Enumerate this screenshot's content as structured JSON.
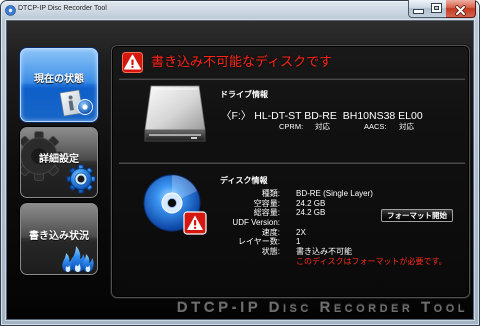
{
  "window": {
    "title": "DTCP-IP Disc Recorder Tool",
    "app_icon": "disc-icon",
    "controls": [
      "minimize-icon",
      "maximize-icon",
      "close-icon"
    ]
  },
  "sidebar": {
    "items": [
      {
        "label": "現在の状態",
        "icon": "info-document-icon",
        "active": true
      },
      {
        "label": "詳細設定",
        "icon": "gear-icon",
        "active": false
      },
      {
        "label": "書き込み状況",
        "icon": "flame-icon",
        "active": false
      }
    ]
  },
  "status": {
    "icon": "warning-icon",
    "message": "書き込み不可能なディスクです"
  },
  "drive": {
    "heading": "ドライブ情報",
    "icon": "optical-drive-icon",
    "name": "〈F:〉 HL-DT-ST BD-RE  BH10NS38 EL00",
    "cprm": {
      "label": "CPRM:",
      "value": "対応"
    },
    "aacs": {
      "label": "AACS:",
      "value": "対応"
    }
  },
  "disc": {
    "heading": "ディスク情報",
    "icon": "disc-warning-icon",
    "rows": [
      {
        "label": "種類:",
        "value": "BD-RE (Single Layer)"
      },
      {
        "label": "空容量:",
        "value": "24.2 GB"
      },
      {
        "label": "総容量:",
        "value": "24.2 GB"
      },
      {
        "label": "UDF Version:"
      },
      {
        "label": "速度:",
        "value": "2X"
      },
      {
        "label": "レイヤー数:",
        "value": "1"
      },
      {
        "label": "状態:",
        "value": "書き込み不可能"
      }
    ],
    "notice": "このディスクはフォーマットが必要です。",
    "format_button": "フォーマット開始"
  },
  "footer": {
    "brand": "DTCP-IP Disc Recorder Tool"
  },
  "colors": {
    "warning_red": "#ff2418",
    "active_blue": "#2c84e4",
    "text_white": "#ffffff",
    "footer_gray": "#6e6e6e"
  }
}
